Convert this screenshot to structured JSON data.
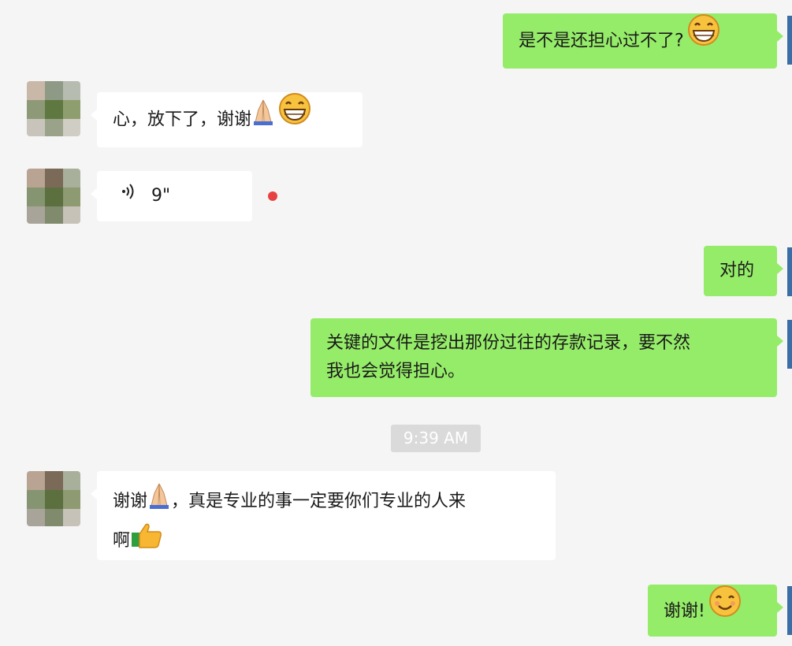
{
  "messages": [
    {
      "id": "m1",
      "direction": "outgoing",
      "text": "是不是还担心过不了?",
      "emoji": "grin-emoji"
    },
    {
      "id": "m2",
      "direction": "incoming",
      "text": "心，放下了，谢谢",
      "emoji": [
        "folded-hands-emoji",
        "grin-emoji"
      ]
    },
    {
      "id": "m3",
      "direction": "incoming",
      "type": "voice",
      "duration": "9\"",
      "unread": true
    },
    {
      "id": "m4",
      "direction": "outgoing",
      "text": "对的"
    },
    {
      "id": "m5",
      "direction": "outgoing",
      "lines": [
        "关键的文件是挖出那份过往的存款记录，要不然",
        "我也会觉得担心。"
      ]
    },
    {
      "id": "ts1",
      "type": "timestamp",
      "text": "9:39 AM"
    },
    {
      "id": "m6",
      "direction": "incoming",
      "lines": [
        "谢谢",
        "，真是专业的事一定要你们专业的人来",
        "啊"
      ],
      "emoji": [
        "folded-hands-emoji",
        "thumbs-up-emoji"
      ]
    },
    {
      "id": "m7",
      "direction": "outgoing",
      "text": "谢谢!",
      "emoji": "smile-emoji"
    }
  ],
  "colors": {
    "outgoing_bubble": "#95ec69",
    "incoming_bubble": "#ffffff",
    "background": "#f5f5f5",
    "unread_dot": "#e64340"
  }
}
